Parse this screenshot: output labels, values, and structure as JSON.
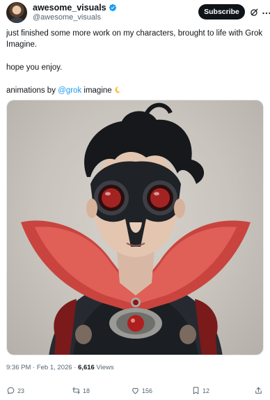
{
  "author": {
    "display_name": "awesome_visuals",
    "handle": "@awesome_visuals"
  },
  "header": {
    "subscribe_label": "Subscribe"
  },
  "post": {
    "line1": "just finished some more work on my characters, brought to life with Grok Imagine.",
    "line2": "hope you enjoy.",
    "line3_prefix": "animations by ",
    "line3_mention": "@grok",
    "line3_suffix": " imagine"
  },
  "media": {
    "alt": ""
  },
  "meta": {
    "time": "9:36 PM",
    "separator": " · ",
    "date": "Feb 1, 2026",
    "separator2": " · ",
    "views_count": "6,616",
    "views_label": " Views"
  },
  "actions": {
    "replies": "23",
    "reposts": "18",
    "likes": "156",
    "bookmarks": "12"
  },
  "colors": {
    "accent": "#1d9bf0",
    "text": "#0f1419",
    "muted": "#536471",
    "subscribe_bg": "#0f1419"
  }
}
